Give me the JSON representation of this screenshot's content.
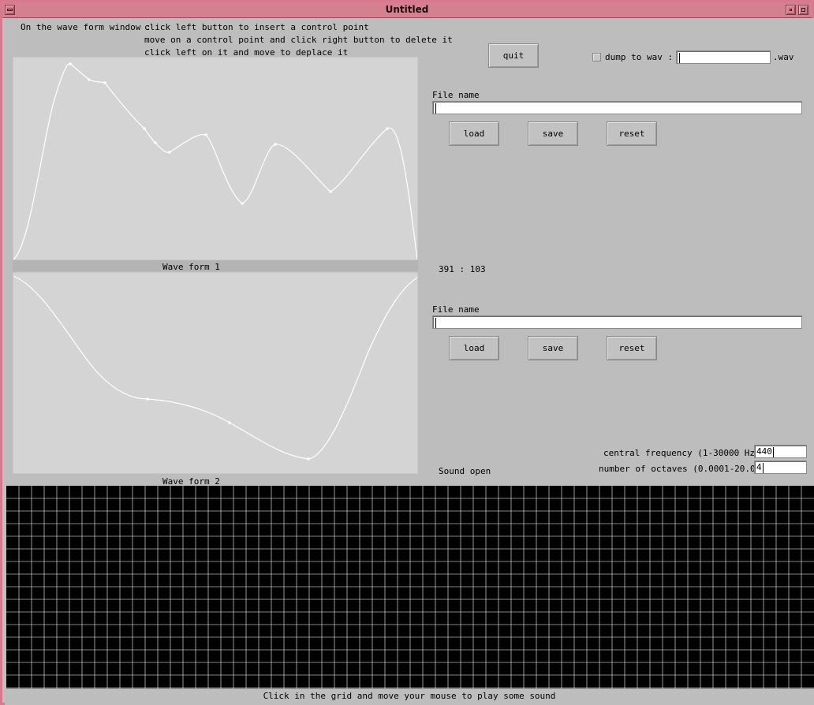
{
  "window": {
    "title": "Untitled"
  },
  "instructions": {
    "prefix": "On the wave form window :",
    "lines": [
      "click left button to insert a control point",
      "move on a control point and click right button to delete it",
      "click left on it and move to deplace it"
    ]
  },
  "quit_label": "quit",
  "dump": {
    "label": "dump to wav :",
    "value": "",
    "suffix": ".wav",
    "checked": false
  },
  "waveform1": {
    "label": "Wave form 1",
    "file_label": "File name",
    "file_value": "",
    "load_label": "load",
    "save_label": "save",
    "reset_label": "reset"
  },
  "waveform2": {
    "label": "Wave form 2",
    "file_label": "File name",
    "file_value": "",
    "load_label": "load",
    "save_label": "save",
    "reset_label": "reset"
  },
  "coords_text": "391 : 103",
  "sound_status": "Sound open",
  "central_frequency": {
    "label": "central frequency (1-30000 Hz)",
    "value": "440"
  },
  "octaves": {
    "label": "number of octaves (0.0001-20.0)",
    "value": "4"
  },
  "footer_text": "Click in the grid and move your mouse to play some sound",
  "colors": {
    "titlebar": "#d4808f",
    "frame": "#d77a8f",
    "panel": "#d4d4d4",
    "grid_bg": "#000000",
    "grid_line": "#ffffff"
  }
}
